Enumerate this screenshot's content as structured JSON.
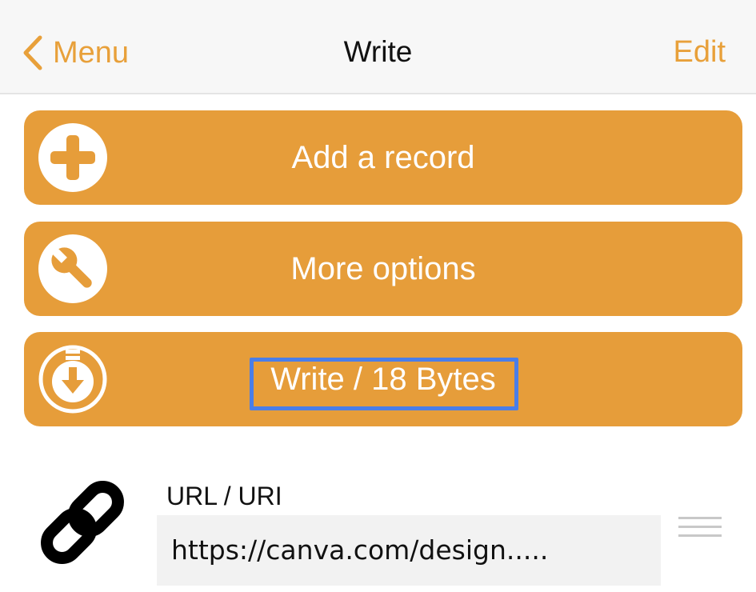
{
  "navbar": {
    "back_label": "Menu",
    "title": "Write",
    "edit_label": "Edit",
    "icons": {
      "back": "chevron-left-icon"
    }
  },
  "actions": [
    {
      "label": "Add a record",
      "icon": "plus-circle-icon"
    },
    {
      "label": "More options",
      "icon": "wrench-circle-icon"
    },
    {
      "label": "Write / 18 Bytes",
      "icon": "download-arrow-circle-icon"
    }
  ],
  "record": {
    "type_label": "URL / URI",
    "value": "https://canva.com/design.....",
    "icons": {
      "type": "link-icon",
      "reorder": "drag-handle-icon"
    }
  },
  "colors": {
    "accent": "#e8a03a",
    "button_bg": "#e69d3a",
    "highlight": "#4a7ee8",
    "navbar_bg": "#f7f7f7"
  }
}
